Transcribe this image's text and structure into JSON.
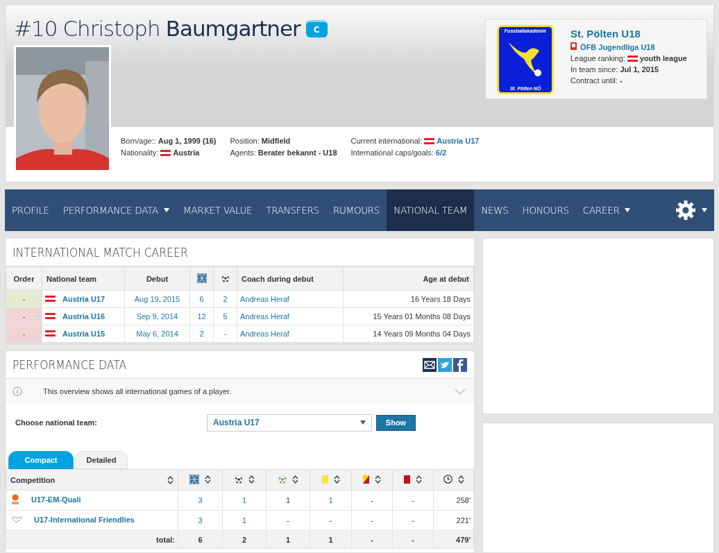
{
  "player": {
    "number": "#10",
    "first_name": "Christoph",
    "last_name": "Baumgartner",
    "badge": "C"
  },
  "details": [
    [
      {
        "label": "Born/age::",
        "value": "Aug 1, 1999 (16)",
        "flag": false,
        "link": false
      },
      {
        "label": "Nationality:",
        "value": "Austria",
        "flag": true,
        "link": false
      }
    ],
    [
      {
        "label": "Position:",
        "value": "Midfield",
        "flag": false,
        "link": false
      },
      {
        "label": "Agents:",
        "value": "Berater bekannt - U18",
        "flag": false,
        "link": false
      }
    ],
    [
      {
        "label": "Current international:",
        "value": "Austria U17",
        "flag": true,
        "link": true
      },
      {
        "label": "International caps/goals:",
        "value": "6/2",
        "flag": false,
        "link": true
      }
    ]
  ],
  "club": {
    "logo_top": "Fussballakademie",
    "logo_bottom": "St. Pölten NÖ",
    "name": "St. Pölten U18",
    "league": "ÖFB Jugendliga U18",
    "facts": [
      {
        "label": "League ranking:",
        "value": "youth league",
        "flag": true
      },
      {
        "label": "In team since:",
        "value": "Jul 1, 2015",
        "flag": false
      },
      {
        "label": "Contract until:",
        "value": "-",
        "flag": false
      }
    ]
  },
  "nav": [
    {
      "label": "PROFILE",
      "selected": false,
      "dropdown": false
    },
    {
      "label": "PERFORMANCE DATA",
      "selected": false,
      "dropdown": true
    },
    {
      "label": "MARKET VALUE",
      "selected": false,
      "dropdown": false
    },
    {
      "label": "TRANSFERS",
      "selected": false,
      "dropdown": false
    },
    {
      "label": "RUMOURS",
      "selected": false,
      "dropdown": false
    },
    {
      "label": "NATIONAL TEAM",
      "selected": true,
      "dropdown": false
    },
    {
      "label": "NEWS",
      "selected": false,
      "dropdown": false
    },
    {
      "label": "HONOURS",
      "selected": false,
      "dropdown": false
    },
    {
      "label": "CAREER",
      "selected": false,
      "dropdown": true
    }
  ],
  "career": {
    "title": "INTERNATIONAL MATCH CAREER",
    "columns": {
      "order": "Order",
      "team": "National team",
      "debut": "Debut",
      "coach": "Coach during debut",
      "age": "Age at debut"
    },
    "rows": [
      {
        "order": "-",
        "color": "#e4ecd2",
        "team": "Austria U17",
        "debut": "Aug 19, 2015",
        "apps": "6",
        "goals": "2",
        "coach": "Andreas Heraf",
        "age": "16 Years 18 Days"
      },
      {
        "order": "-",
        "color": "#f2d4d6",
        "team": "Austria U16",
        "debut": "Sep 9, 2014",
        "apps": "12",
        "goals": "5",
        "coach": "Andreas Heraf",
        "age": "15 Years 01 Months 08 Days"
      },
      {
        "order": "-",
        "color": "#f2d4d6",
        "team": "Austria U15",
        "debut": "May 6, 2014",
        "apps": "2",
        "goals": "-",
        "coach": "Andreas Heraf",
        "age": "14 Years 09 Months 04 Days"
      }
    ]
  },
  "performance": {
    "title": "PERFORMANCE DATA",
    "info": "This overview shows all international games of a player.",
    "choose_label": "Choose national team:",
    "select_value": "Austria U17",
    "show_button": "Show",
    "tabs": [
      {
        "label": "Compact",
        "selected": true
      },
      {
        "label": "Detailed",
        "selected": false
      }
    ],
    "competition_header": "Competition",
    "rows": [
      {
        "kind": "qualifier",
        "name": "U17-EM-Quali",
        "cells": [
          {
            "text": "3",
            "link": true
          },
          {
            "text": "1",
            "link": true
          },
          {
            "text": "1",
            "link": false
          },
          {
            "text": "1",
            "link": true
          },
          {
            "text": "-",
            "link": false
          },
          {
            "text": "-",
            "link": false
          },
          {
            "text": "258'",
            "link": false
          }
        ]
      },
      {
        "kind": "friendly",
        "name": "U17-International Friendlies",
        "cells": [
          {
            "text": "3",
            "link": true
          },
          {
            "text": "1",
            "link": true
          },
          {
            "text": "-",
            "link": false
          },
          {
            "text": "-",
            "link": false
          },
          {
            "text": "-",
            "link": false
          },
          {
            "text": "-",
            "link": false
          },
          {
            "text": "221'",
            "link": false
          }
        ]
      }
    ],
    "total": {
      "label": "total:",
      "cells": [
        "6",
        "2",
        "1",
        "1",
        "-",
        "-",
        "479'"
      ]
    }
  }
}
